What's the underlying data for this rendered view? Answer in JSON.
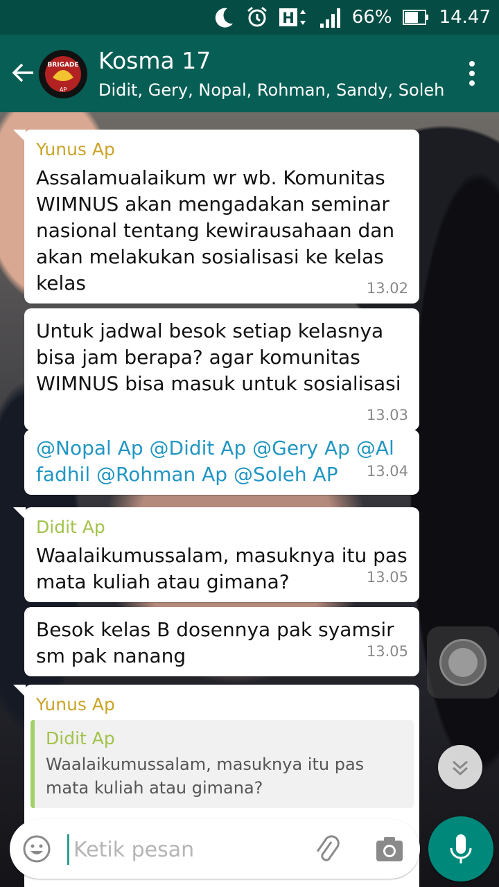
{
  "status_bar": {
    "battery": "66%",
    "time": "14.47"
  },
  "header": {
    "title": "Kosma 17",
    "subtitle": "Didit, Gery, Nopal, Rohman, Sandy, Soleh, ...",
    "avatar_text": "2016 BRIGADE AP"
  },
  "messages": [
    {
      "sender": "Yunus Ap",
      "sender_color": "#cba42a",
      "text": "Assalamualaikum wr wb. Komunitas WIMNUS akan mengadakan seminar nasional tentang kewirausahaan dan akan melakukan sosialisasi ke kelas kelas",
      "time": "13.02"
    },
    {
      "text": "Untuk jadwal besok setiap kelasnya bisa jam berapa? agar komunitas WIMNUS bisa masuk untuk sosialisasi",
      "time": "13.03"
    },
    {
      "mentions": [
        "@Nopal Ap",
        "@Didit Ap",
        "@Gery Ap",
        "@Al fadhil",
        "@Rohman Ap",
        "@Soleh AP"
      ],
      "time": "13.04"
    },
    {
      "sender": "Didit Ap",
      "sender_color": "#a2c24b",
      "text": "Waalaikumussalam, masuknya itu pas mata kuliah atau gimana?",
      "time": "13.05"
    },
    {
      "text": "Besok kelas B dosennya pak syamsir sm pak nanang",
      "time": "13.05"
    },
    {
      "sender": "Yunus Ap",
      "sender_color": "#cba42a",
      "quote": {
        "sender": "Didit Ap",
        "text": "Waalaikumussalam, masuknya itu pas mata kuliah atau gimana?"
      }
    }
  ],
  "composer": {
    "placeholder": "Ketik pesan"
  },
  "colors": {
    "header": "#075e54",
    "status": "#054d44",
    "accent": "#00897b",
    "mention": "#2196c3"
  },
  "icons": [
    "moon-icon",
    "alarm-icon",
    "hplus-signal-icon",
    "cell-signal-icon",
    "battery-icon",
    "back-arrow-icon",
    "more-vert-icon",
    "emoji-icon",
    "attach-icon",
    "camera-icon",
    "mic-icon",
    "chevron-double-down-icon"
  ]
}
